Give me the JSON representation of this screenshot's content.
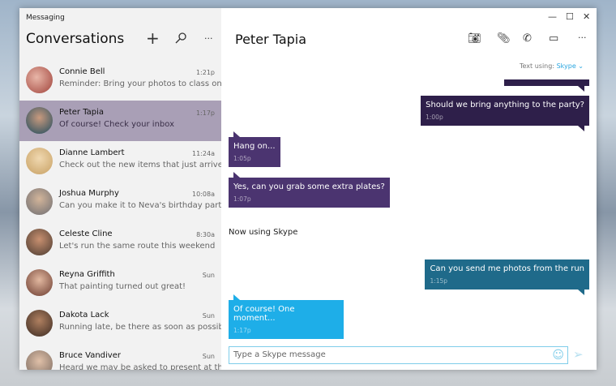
{
  "app_title": "Messaging",
  "sidebar": {
    "title": "Conversations",
    "icons": [
      "plus-icon",
      "search-icon",
      "more-icon"
    ],
    "conversations": [
      {
        "name": "Connie Bell",
        "time": "1:21p",
        "preview": "Reminder: Bring your photos to class on Thu",
        "selected": false
      },
      {
        "name": "Peter Tapia",
        "time": "1:17p",
        "preview": "Of course! Check your inbox",
        "selected": true
      },
      {
        "name": "Dianne Lambert",
        "time": "11:24a",
        "preview": "Check out the new items that just arrived",
        "selected": false
      },
      {
        "name": "Joshua Murphy",
        "time": "10:08a",
        "preview": "Can you make it to Neva's birthday party?",
        "selected": false
      },
      {
        "name": "Celeste Cline",
        "time": "8:30a",
        "preview": "Let's run the same route this weekend",
        "selected": false
      },
      {
        "name": "Reyna Griffith",
        "time": "Sun",
        "preview": "That painting turned out great!",
        "selected": false
      },
      {
        "name": "Dakota Lack",
        "time": "Sun",
        "preview": "Running late, be there as soon as possible",
        "selected": false
      },
      {
        "name": "Bruce Vandiver",
        "time": "Sun",
        "preview": "Heard we may be asked to present at the s",
        "selected": false
      }
    ]
  },
  "chat": {
    "title": "Peter Tapia",
    "text_using_label": "Text using:",
    "text_using_service": "Skype",
    "messages": [
      {
        "text": "Should we bring anything to the party?",
        "time": "1:00p",
        "dir": "out"
      },
      {
        "text": "Hang on...",
        "time": "1:05p",
        "dir": "in"
      },
      {
        "text": "Yes, can you grab some extra plates?",
        "time": "1:07p",
        "dir": "in"
      },
      {
        "text": "Can you send me photos from the run",
        "time": "1:15p",
        "dir": "out"
      },
      {
        "text": "Of course!  One moment...",
        "time": "1:17p",
        "dir": "in"
      }
    ],
    "system_message": "Now using Skype",
    "input_placeholder": "Type a Skype message"
  },
  "colors": {
    "selected": "#a99fb6",
    "dark_purple": "#2e1f4a",
    "purple": "#4b3470",
    "teal": "#1f6a8a",
    "skype_blue": "#1eaee8"
  }
}
